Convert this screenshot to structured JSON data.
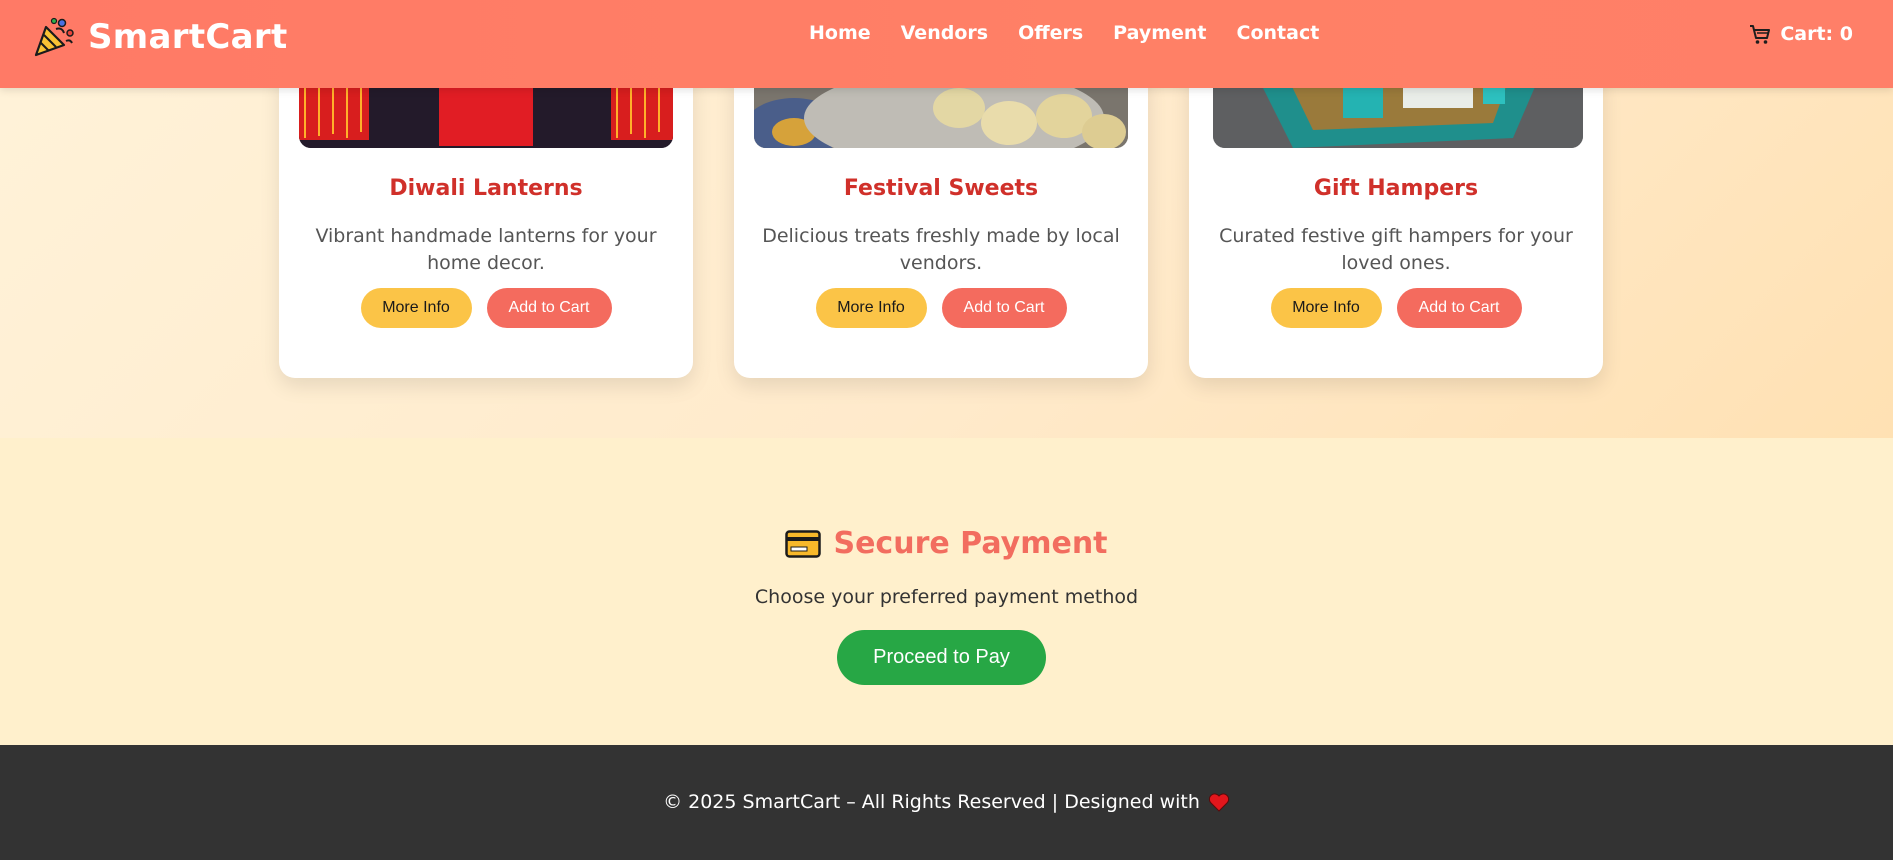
{
  "header": {
    "brand": "SmartCart",
    "logo_icon": "party-popper-icon",
    "nav": [
      "Home",
      "Vendors",
      "Offers",
      "Payment",
      "Contact"
    ],
    "cart_label": "Cart: 0",
    "cart_icon": "shopping-cart-icon"
  },
  "products": [
    {
      "title": "Diwali Lanterns",
      "description": "Vibrant handmade lanterns for your home decor.",
      "more_info": "More Info",
      "add_to_cart": "Add to Cart"
    },
    {
      "title": "Festival Sweets",
      "description": "Delicious treats freshly made by local vendors.",
      "more_info": "More Info",
      "add_to_cart": "Add to Cart"
    },
    {
      "title": "Gift Hampers",
      "description": "Curated festive gift hampers for your loved ones.",
      "more_info": "More Info",
      "add_to_cart": "Add to Cart"
    }
  ],
  "payment": {
    "icon": "credit-card-icon",
    "title": "Secure Payment",
    "subtitle": "Choose your preferred payment method",
    "button": "Proceed to Pay"
  },
  "footer": {
    "text": "© 2025 SmartCart – All Rights Reserved | Designed with",
    "icon": "heart-icon"
  },
  "colors": {
    "navbar": "#ff7a66",
    "card_title": "#d0302a",
    "more_info_button": "#fbc447",
    "add_to_cart_button": "#f46b5e",
    "pay_button": "#27a745",
    "footer": "#333333"
  }
}
